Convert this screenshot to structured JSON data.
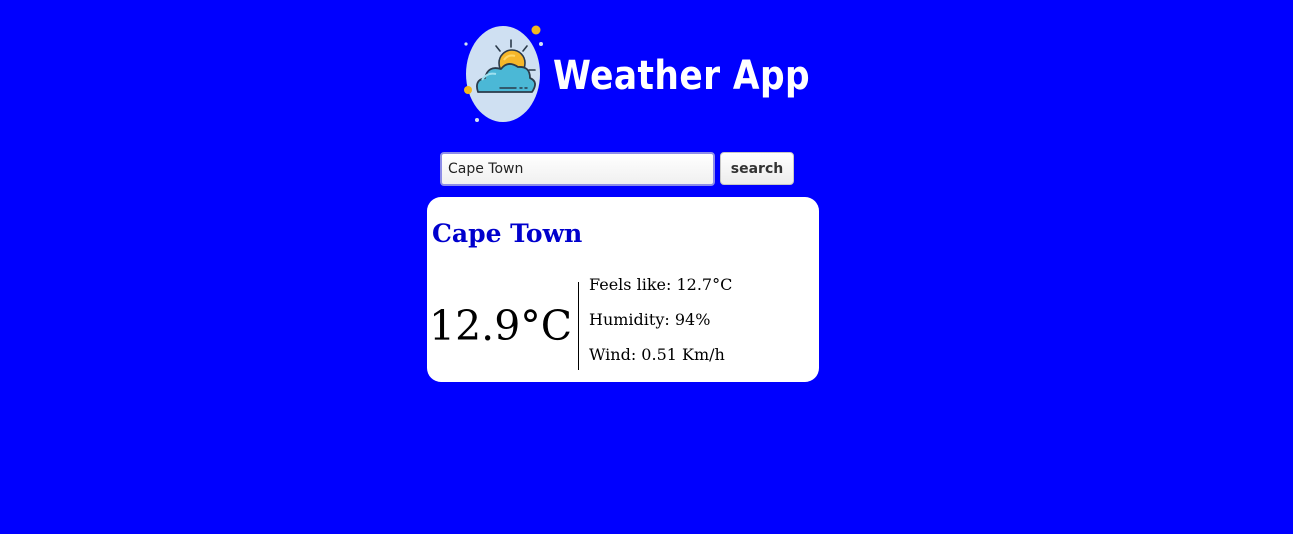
{
  "app": {
    "title": "Weather App",
    "logo_icon": "weather-cloud-sun-icon",
    "background_color": "#0000FF"
  },
  "search": {
    "value": "Cape Town",
    "button_label": "search"
  },
  "weather": {
    "city": "Cape Town",
    "city_color": "#0000CD",
    "temperature": "12.9°C",
    "feels_like": "Feels like: 12.7°C",
    "humidity": "Humidity: 94%",
    "wind": "Wind: 0.51 Km/h"
  }
}
